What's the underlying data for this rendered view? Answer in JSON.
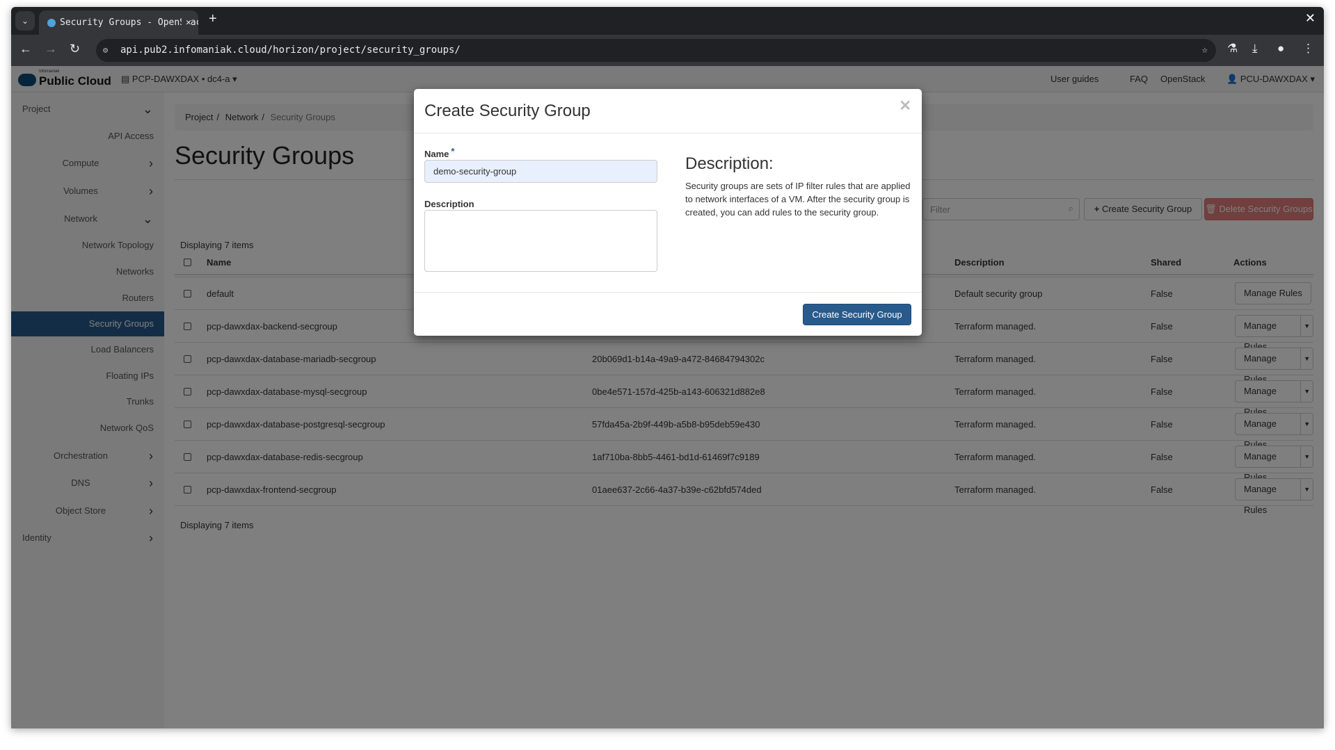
{
  "browser": {
    "tab_title": "Security Groups - OpenStack",
    "url": "api.pub2.infomaniak.cloud/horizon/project/security_groups/"
  },
  "header": {
    "logo_small": "Infomaniak",
    "logo_big": "Public Cloud",
    "project": "PCP-DAWXDAX • dc4-a ▾",
    "links": [
      "User guides",
      "FAQ",
      "OpenStack"
    ],
    "user": "PCU-DAWXDAX ▾"
  },
  "sidebar": {
    "items": [
      {
        "label": "Project",
        "chevron": "down"
      },
      {
        "label": "API Access"
      },
      {
        "label": "Compute",
        "chevron": "right"
      },
      {
        "label": "Volumes",
        "chevron": "right"
      },
      {
        "label": "Network",
        "chevron": "down"
      },
      {
        "label": "Network Topology"
      },
      {
        "label": "Networks"
      },
      {
        "label": "Routers"
      },
      {
        "label": "Security Groups",
        "active": true
      },
      {
        "label": "Load Balancers"
      },
      {
        "label": "Floating IPs"
      },
      {
        "label": "Trunks"
      },
      {
        "label": "Network QoS"
      },
      {
        "label": "Orchestration",
        "chevron": "right"
      },
      {
        "label": "DNS",
        "chevron": "right"
      },
      {
        "label": "Object Store",
        "chevron": "right"
      },
      {
        "label": "Identity",
        "chevron": "right"
      }
    ]
  },
  "breadcrumb": [
    "Project",
    "Network",
    "Security Groups"
  ],
  "page_title": "Security Groups",
  "toolbar": {
    "filter_placeholder": "Filter",
    "create": "Create Security Group",
    "delete": "Delete Security Groups"
  },
  "table": {
    "count": "Displaying 7 items",
    "columns": [
      "Name",
      "Description",
      "Shared",
      "Actions"
    ],
    "rows": [
      {
        "name": "default",
        "id": "",
        "description": "Default security group",
        "shared": "False",
        "action": "Manage Rules",
        "dropdown": false
      },
      {
        "name": "pcp-dawxdax-backend-secgroup",
        "id": "",
        "description": "Terraform managed.",
        "shared": "False",
        "action": "Manage Rules",
        "dropdown": true
      },
      {
        "name": "pcp-dawxdax-database-mariadb-secgroup",
        "id": "20b069d1-b14a-49a9-a472-84684794302c",
        "description": "Terraform managed.",
        "shared": "False",
        "action": "Manage Rules",
        "dropdown": true
      },
      {
        "name": "pcp-dawxdax-database-mysql-secgroup",
        "id": "0be4e571-157d-425b-a143-606321d882e8",
        "description": "Terraform managed.",
        "shared": "False",
        "action": "Manage Rules",
        "dropdown": true
      },
      {
        "name": "pcp-dawxdax-database-postgresql-secgroup",
        "id": "57fda45a-2b9f-449b-a5b8-b95deb59e430",
        "description": "Terraform managed.",
        "shared": "False",
        "action": "Manage Rules",
        "dropdown": true
      },
      {
        "name": "pcp-dawxdax-database-redis-secgroup",
        "id": "1af710ba-8bb5-4461-bd1d-61469f7c9189",
        "description": "Terraform managed.",
        "shared": "False",
        "action": "Manage Rules",
        "dropdown": true
      },
      {
        "name": "pcp-dawxdax-frontend-secgroup",
        "id": "01aee637-2c66-4a37-b39e-c62bfd574ded",
        "description": "Terraform managed.",
        "shared": "False",
        "action": "Manage Rules",
        "dropdown": true
      }
    ]
  },
  "modal": {
    "title": "Create Security Group",
    "name_label": "Name",
    "required": "*",
    "name_value": "demo-security-group",
    "desc_label": "Description",
    "desc_value": "",
    "help_heading": "Description:",
    "help_text": "Security groups are sets of IP filter rules that are applied to network interfaces of a VM. After the security group is created, you can add rules to the security group.",
    "submit": "Create Security Group"
  },
  "colors": {
    "primary": "#285b8c",
    "danger": "#d9534f",
    "autofill": "#e8f0fe"
  }
}
